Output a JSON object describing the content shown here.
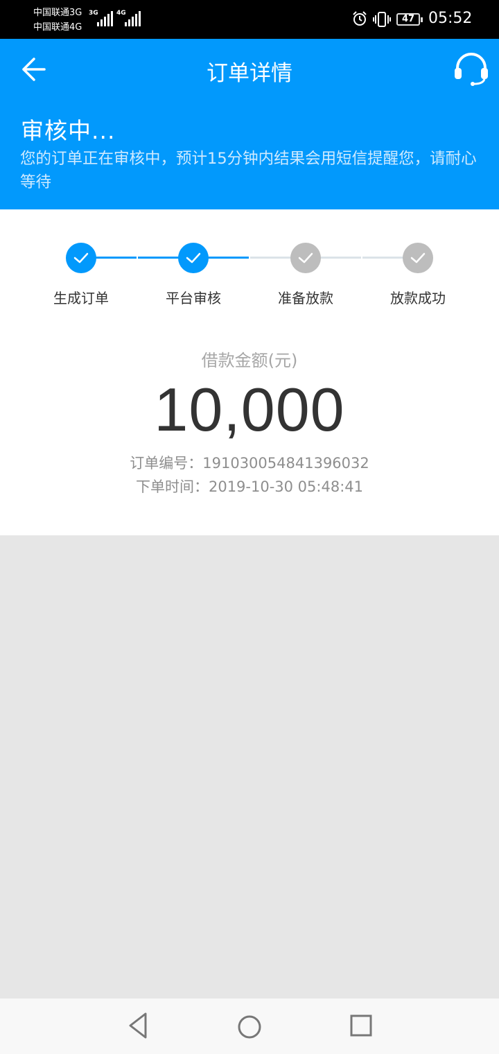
{
  "status_bar": {
    "carrier_1": "中国联通3G",
    "carrier_2": "中国联通4G",
    "net_1": "3G",
    "net_2": "4G",
    "battery": "47",
    "time": "05:52",
    "icons": [
      "alarm-icon",
      "vibrate-icon",
      "battery-icon"
    ]
  },
  "header": {
    "title": "订单详情",
    "back_icon": "arrow-left-icon",
    "service_icon": "headset-icon",
    "status_title": "审核中...",
    "status_desc": "您的订单正在审核中，预计15分钟内结果会用短信提醒您，请耐心等待"
  },
  "progress": {
    "steps": [
      {
        "label": "生成订单",
        "done": true
      },
      {
        "label": "平台审核",
        "done": true
      },
      {
        "label": "准备放款",
        "done": false
      },
      {
        "label": "放款成功",
        "done": false
      }
    ]
  },
  "order": {
    "amount_label": "借款金额(元)",
    "amount": "10,000",
    "order_no_label": "订单编号：",
    "order_no": "191030054841396032",
    "time_label": "下单时间：",
    "time": "2019-10-30 05:48:41"
  },
  "colors": {
    "brand": "#0299fc",
    "step_done": "#0299fc",
    "step_pending": "#bdbdbd",
    "line_pending": "#dbe3e8"
  },
  "nav": {
    "icons": [
      "nav-back-icon",
      "nav-home-icon",
      "nav-recent-icon"
    ]
  }
}
